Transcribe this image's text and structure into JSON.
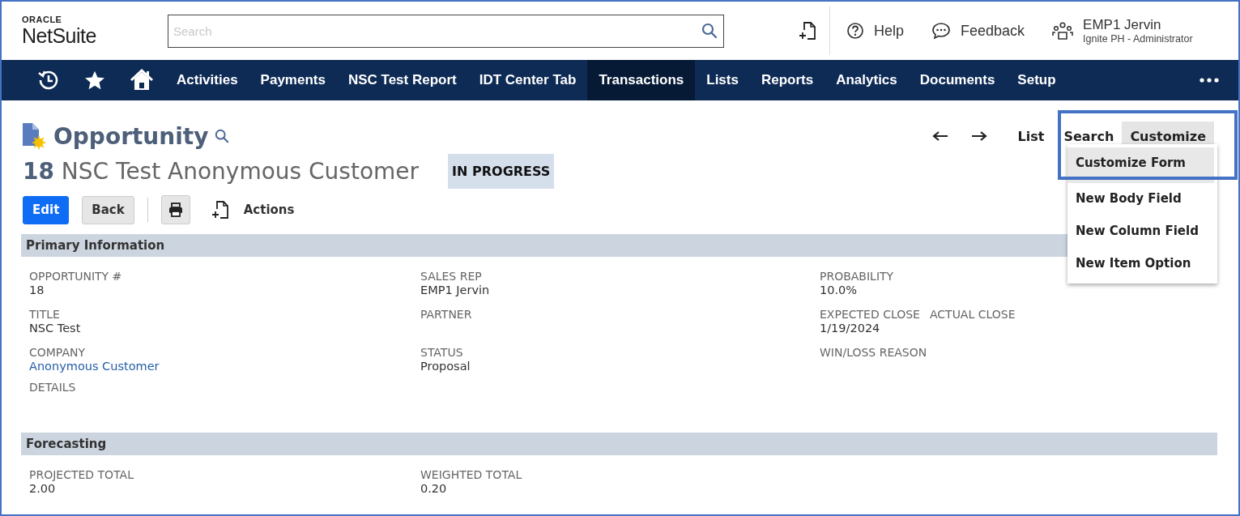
{
  "brand": {
    "line_1": "ORACLE",
    "line_2": "NetSuite"
  },
  "search": {
    "placeholder": "Search"
  },
  "header_links": [
    {
      "kind": "help",
      "label": "Help"
    },
    {
      "kind": "feedback",
      "label": "Feedback"
    }
  ],
  "user": {
    "name": "EMP1 Jervin",
    "role": "Ignite PH - Administrator"
  },
  "nav": [
    {
      "label": "Activities",
      "selected": false
    },
    {
      "label": "Payments",
      "selected": false
    },
    {
      "label": "NSC Test Report",
      "selected": false
    },
    {
      "label": "IDT Center Tab",
      "selected": false
    },
    {
      "label": "Transactions",
      "selected": true
    },
    {
      "label": "Lists",
      "selected": false
    },
    {
      "label": "Reports",
      "selected": false
    },
    {
      "label": "Analytics",
      "selected": false
    },
    {
      "label": "Documents",
      "selected": false
    },
    {
      "label": "Setup",
      "selected": false
    }
  ],
  "record": {
    "type": "Opportunity",
    "number": "18",
    "name": "NSC Test Anonymous Customer",
    "status": "IN PROGRESS"
  },
  "top_links": [
    {
      "label": "List",
      "selected": false
    },
    {
      "label": "Search",
      "selected": false
    },
    {
      "label": "Customize",
      "selected": true
    }
  ],
  "customize_menu": [
    {
      "label": "Customize Form",
      "selected": true
    },
    {
      "label": "New Body Field",
      "selected": false
    },
    {
      "label": "New Column Field",
      "selected": false
    },
    {
      "label": "New Item Option",
      "selected": false
    }
  ],
  "buttons": [
    {
      "kind": "primary",
      "label": "Edit"
    },
    {
      "kind": "secondary",
      "label": "Back"
    }
  ],
  "actions": {
    "label": "Actions"
  },
  "sections": [
    {
      "title": "Primary Information",
      "columns": [
        [
          {
            "label": "OPPORTUNITY #",
            "value": "18"
          },
          {
            "label": "TITLE",
            "value": "NSC Test"
          },
          {
            "label": "COMPANY",
            "value": "Anonymous Customer",
            "kind": "link"
          }
        ],
        [
          {
            "label": "SALES REP",
            "value": "EMP1 Jervin"
          },
          {
            "label": "PARTNER"
          },
          {
            "label": "STATUS",
            "value": "Proposal"
          }
        ],
        [
          {
            "label": "PROBABILITY",
            "value": "10.0%"
          },
          {
            "label": "EXPECTED CLOSE",
            "label_2": "ACTUAL CLOSE",
            "value": "1/19/2024"
          },
          {
            "label": "WIN/LOSS REASON"
          }
        ]
      ],
      "footer_label": "DETAILS"
    },
    {
      "title": "Forecasting",
      "columns": [
        [
          {
            "label": "PROJECTED TOTAL",
            "value": "2.00"
          }
        ],
        [
          {
            "label": "WEIGHTED TOTAL",
            "value": "0.20"
          }
        ]
      ]
    }
  ],
  "annotation": {
    "kind": "highlight_box"
  }
}
